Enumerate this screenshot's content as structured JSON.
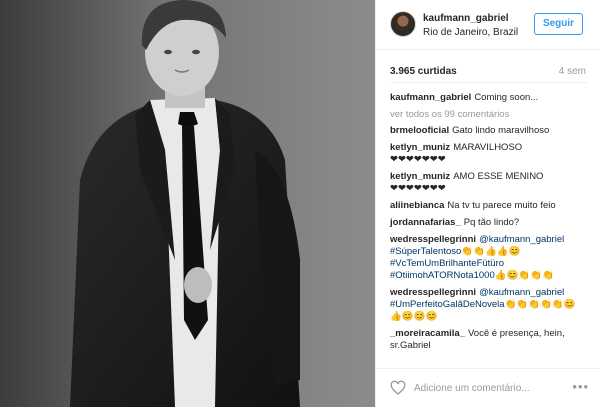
{
  "header": {
    "username": "kaufmann_gabriel",
    "location": "Rio de Janeiro, Brazil",
    "follow_label": "Seguir"
  },
  "stats": {
    "likes": "3.965 curtidas",
    "time": "4 sem"
  },
  "caption": {
    "user": "kaufmann_gabriel",
    "text": "Coming soon..."
  },
  "view_all": "ver todos os 99 comentários",
  "comments": [
    {
      "user": "brmelooficial",
      "lines": [
        "Gato lindo maravilhoso"
      ]
    },
    {
      "user": "ketlyn_muniz",
      "lines": [
        "MARAVILHOSO",
        "❤❤❤❤❤❤❤"
      ]
    },
    {
      "user": "ketlyn_muniz",
      "lines": [
        "AMO ESSE MENINO",
        "❤❤❤❤❤❤❤"
      ]
    },
    {
      "user": "aliinebianca",
      "lines": [
        "Na tv tu parece muito feio"
      ]
    },
    {
      "user": "jordannafarias_",
      "lines": [
        "Pq tão lindo?"
      ]
    },
    {
      "user": "wedresspellegrinni",
      "tag_lines": [
        "@kaufmann_gabriel",
        "#SúperTalentoso",
        "#VcTemUmBrilhanteFütüro",
        "#OtiimohATORNota1000"
      ],
      "emoji_lines": [
        "👏👏👍👍😊",
        "",
        "👍😊👏👏👏"
      ]
    },
    {
      "user": "wedresspellegrinni",
      "tag_lines": [
        "@kaufmann_gabriel",
        "#UmPerfeitoGalãDeNovela"
      ],
      "emoji_lines": [
        "👏👏👏👏👏😊",
        "👍😊😊😊"
      ]
    },
    {
      "user": "_moreiracamila_",
      "lines": [
        "Você é presença, hein,",
        "sr.Gabriel"
      ]
    }
  ],
  "footer": {
    "placeholder": "Adicione um comentário...",
    "more": "•••"
  }
}
